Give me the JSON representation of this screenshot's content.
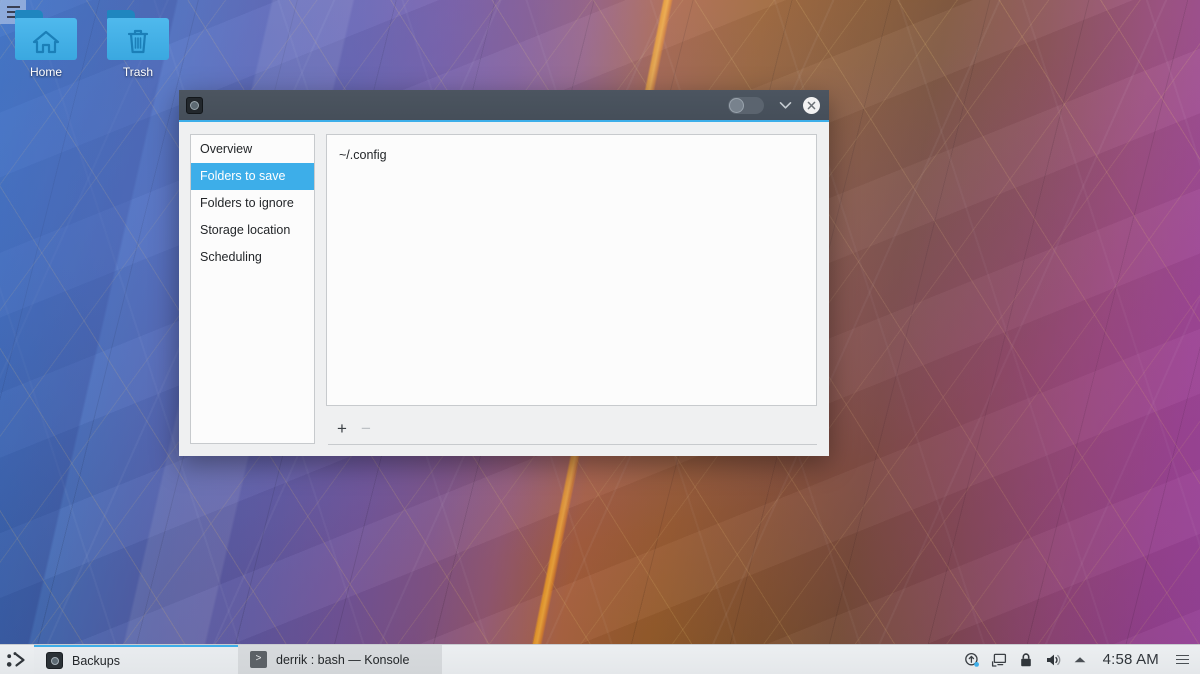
{
  "desktop": {
    "toolbox_icon": "hamburger-icon",
    "icons": [
      {
        "label": "Home",
        "glyph": "home-icon"
      },
      {
        "label": "Trash",
        "glyph": "trash-icon"
      }
    ]
  },
  "window": {
    "title": "",
    "app_icon": "backups-app-icon",
    "controls": {
      "toggle": "keep-above-toggle",
      "shade": "chevron-down-icon",
      "close": "close-icon"
    },
    "sidebar": {
      "items": [
        {
          "label": "Overview",
          "selected": false
        },
        {
          "label": "Folders to save",
          "selected": true
        },
        {
          "label": "Folders to ignore",
          "selected": false
        },
        {
          "label": "Storage location",
          "selected": false
        },
        {
          "label": "Scheduling",
          "selected": false
        }
      ]
    },
    "folder_list": {
      "entries": [
        "~/.config"
      ]
    },
    "actions": {
      "add_label": "+",
      "add_enabled": true,
      "remove_label": "−",
      "remove_enabled": false
    }
  },
  "taskbar": {
    "launcher": "kde-launcher-icon",
    "tasks": [
      {
        "label": "Backups",
        "icon": "backups-app-icon",
        "state": "active"
      },
      {
        "label": "derrik : bash — Konsole",
        "icon": "konsole-icon",
        "state": "inactive"
      }
    ],
    "tray": {
      "icons": [
        "software-update-icon",
        "display-icon",
        "lock-icon",
        "volume-icon",
        "show-hidden-icon"
      ],
      "clock": "4:58 AM",
      "menu": "hamburger-icon"
    }
  },
  "colors": {
    "accent": "#3daee9",
    "titlebar": "#454e59",
    "window_bg": "#eff0f1",
    "list_bg": "#fcfcfc",
    "text": "#232629"
  }
}
